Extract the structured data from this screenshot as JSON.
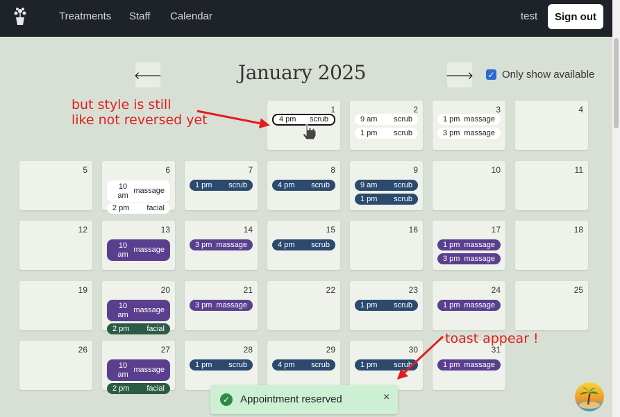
{
  "nav": {
    "links": [
      "Treatments",
      "Staff",
      "Calendar"
    ],
    "user": "test",
    "signout_label": "Sign out"
  },
  "header": {
    "month_title": "January 2025",
    "only_available_label": "Only show available",
    "only_available_checked": true
  },
  "annotations": {
    "style_note_line1": "but style is still",
    "style_note_line2": "like not reversed yet",
    "toast_note": "toast appear !"
  },
  "days": {
    "d1": {
      "num": "1",
      "slots": [
        {
          "time": "4 pm",
          "service": "scrub"
        }
      ]
    },
    "d2": {
      "num": "2",
      "slots": [
        {
          "time": "9 am",
          "service": "scrub"
        },
        {
          "time": "1 pm",
          "service": "scrub"
        }
      ]
    },
    "d3": {
      "num": "3",
      "slots": [
        {
          "time": "1 pm",
          "service": "massage"
        },
        {
          "time": "3 pm",
          "service": "massage"
        }
      ]
    },
    "d4": {
      "num": "4"
    },
    "d5": {
      "num": "5"
    },
    "d6": {
      "num": "6",
      "slots": [
        {
          "time": "10 am",
          "service": "massage"
        },
        {
          "time": "2 pm",
          "service": "facial"
        }
      ]
    },
    "d7": {
      "num": "7",
      "slots": [
        {
          "time": "1 pm",
          "service": "scrub"
        }
      ]
    },
    "d8": {
      "num": "8",
      "slots": [
        {
          "time": "4 pm",
          "service": "scrub"
        }
      ]
    },
    "d9": {
      "num": "9",
      "slots": [
        {
          "time": "9 am",
          "service": "scrub"
        },
        {
          "time": "1 pm",
          "service": "scrub"
        }
      ]
    },
    "d10": {
      "num": "10"
    },
    "d11": {
      "num": "11"
    },
    "d12": {
      "num": "12"
    },
    "d13": {
      "num": "13",
      "slots": [
        {
          "time": "10 am",
          "service": "massage"
        }
      ]
    },
    "d14": {
      "num": "14",
      "slots": [
        {
          "time": "3 pm",
          "service": "massage"
        }
      ]
    },
    "d15": {
      "num": "15",
      "slots": [
        {
          "time": "4 pm",
          "service": "scrub"
        }
      ]
    },
    "d16": {
      "num": "16"
    },
    "d17": {
      "num": "17",
      "slots": [
        {
          "time": "1 pm",
          "service": "massage"
        },
        {
          "time": "3 pm",
          "service": "massage"
        }
      ]
    },
    "d18": {
      "num": "18"
    },
    "d19": {
      "num": "19"
    },
    "d20": {
      "num": "20",
      "slots": [
        {
          "time": "10 am",
          "service": "massage"
        },
        {
          "time": "2 pm",
          "service": "facial"
        }
      ]
    },
    "d21": {
      "num": "21",
      "slots": [
        {
          "time": "3 pm",
          "service": "massage"
        }
      ]
    },
    "d22": {
      "num": "22"
    },
    "d23": {
      "num": "23",
      "slots": [
        {
          "time": "1 pm",
          "service": "scrub"
        }
      ]
    },
    "d24": {
      "num": "24",
      "slots": [
        {
          "time": "1 pm",
          "service": "massage"
        }
      ]
    },
    "d25": {
      "num": "25"
    },
    "d26": {
      "num": "26"
    },
    "d27": {
      "num": "27",
      "slots": [
        {
          "time": "10 am",
          "service": "massage"
        },
        {
          "time": "2 pm",
          "service": "facial"
        }
      ]
    },
    "d28": {
      "num": "28",
      "slots": [
        {
          "time": "1 pm",
          "service": "scrub"
        }
      ]
    },
    "d29": {
      "num": "29",
      "slots": [
        {
          "time": "4 pm",
          "service": "scrub"
        }
      ]
    },
    "d30": {
      "num": "30",
      "slots": [
        {
          "time": "1 pm",
          "service": "scrub"
        }
      ]
    },
    "d31": {
      "num": "31",
      "slots": [
        {
          "time": "1 pm",
          "service": "massage"
        }
      ]
    }
  },
  "toast": {
    "message": "Appointment reserved",
    "close_glyph": "×"
  },
  "colors": {
    "scrub": "#2c4a6e",
    "massage": "#5a3f8f",
    "facial": "#2d5a45",
    "annotation": "#e01e1e"
  }
}
